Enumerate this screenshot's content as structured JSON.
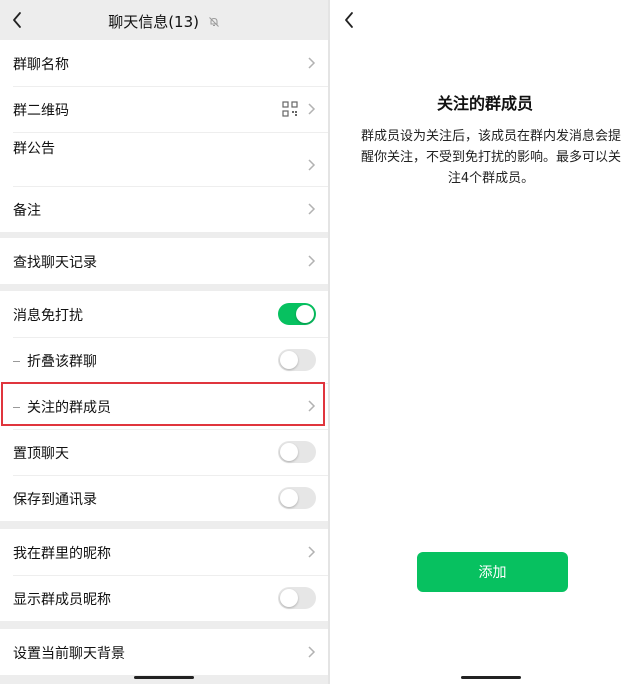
{
  "left": {
    "header": {
      "title": "聊天信息(13)"
    },
    "group1": [
      {
        "label": "群聊名称"
      },
      {
        "label": "群二维码"
      },
      {
        "label": "群公告"
      },
      {
        "label": "备注"
      }
    ],
    "group2": [
      {
        "label": "查找聊天记录"
      }
    ],
    "group3": [
      {
        "label": "消息免打扰",
        "toggle": true
      },
      {
        "label": "折叠该群聊",
        "toggle": false
      },
      {
        "label": "关注的群成员"
      },
      {
        "label": "置顶聊天",
        "toggle": false
      },
      {
        "label": "保存到通讯录",
        "toggle": false
      }
    ],
    "group4": [
      {
        "label": "我在群里的昵称"
      },
      {
        "label": "显示群成员昵称",
        "toggle": false
      }
    ],
    "group5": [
      {
        "label": "设置当前聊天背景"
      }
    ]
  },
  "right": {
    "title": "关注的群成员",
    "description": "群成员设为关注后，该成员在群内发消息会提醒你关注，不受到免打扰的影响。最多可以关注4个群成员。",
    "add_label": "添加"
  },
  "colors": {
    "accent": "#07c160",
    "highlight": "#e0353d",
    "background": "#ededed"
  }
}
